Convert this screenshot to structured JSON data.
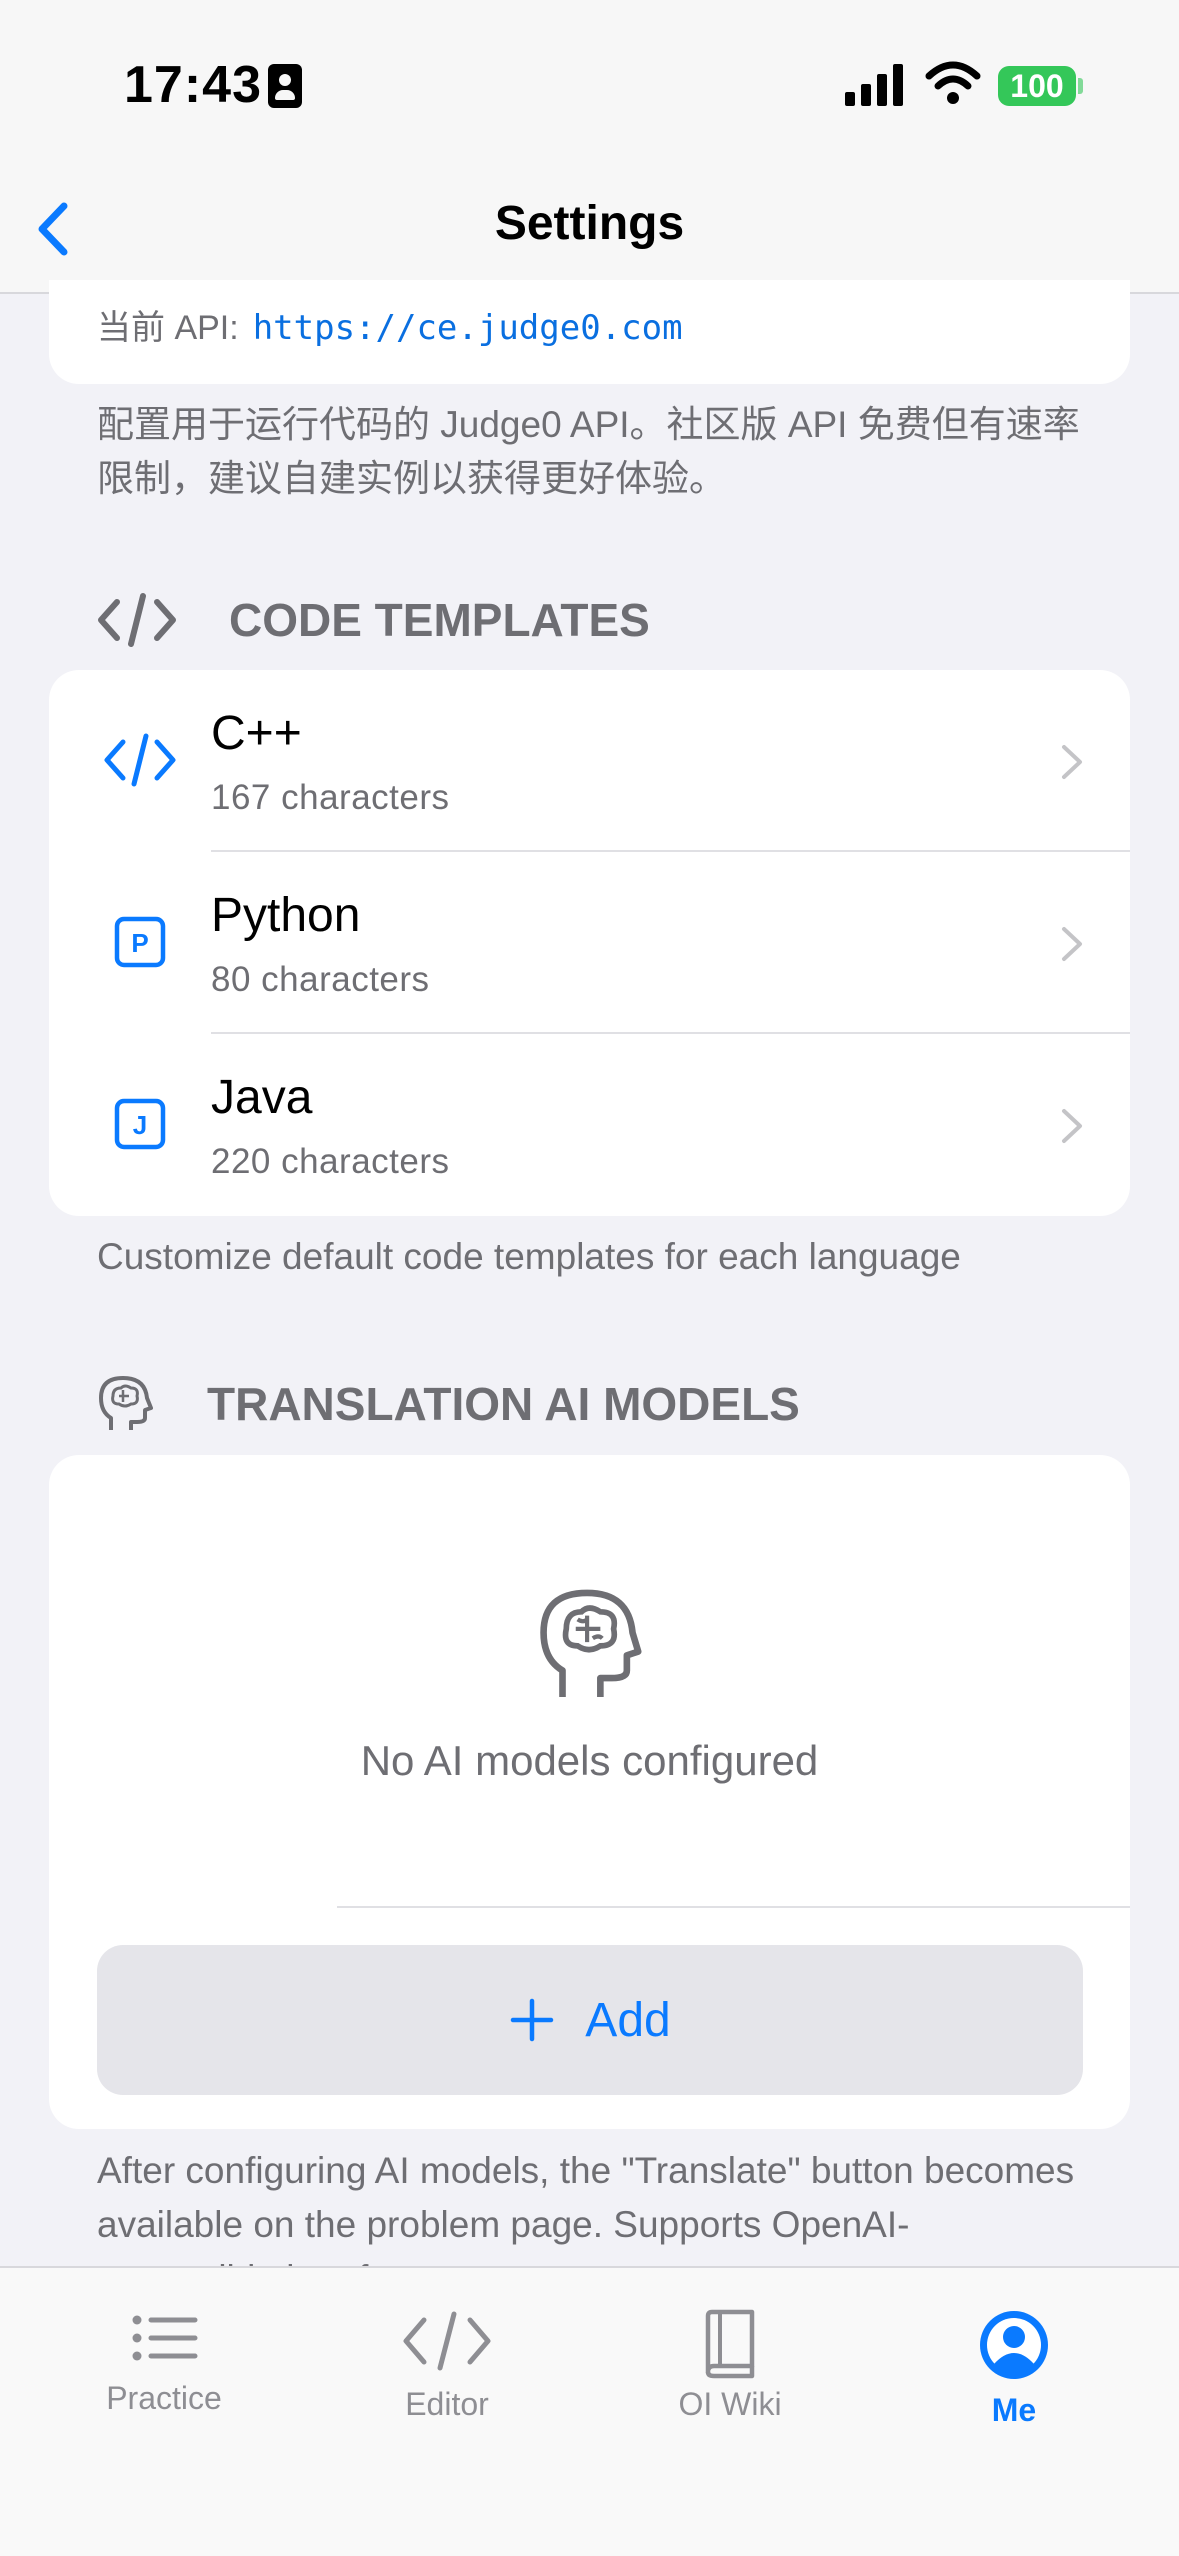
{
  "status_bar": {
    "time": "17:43",
    "battery": "100"
  },
  "nav": {
    "title": "Settings"
  },
  "api": {
    "label": "当前 API:",
    "url": "https://ce.judge0.com",
    "footnote": "配置用于运行代码的 Judge0 API。社区版 API 免费但有速率限制，建议自建实例以获得更好体验。"
  },
  "templates": {
    "header": "CODE TEMPLATES",
    "items": [
      {
        "name": "C++",
        "detail": "167 characters",
        "icon": "code-brackets-icon"
      },
      {
        "name": "Python",
        "detail": "80 characters",
        "icon": "letter-p-square-icon",
        "letter": "P"
      },
      {
        "name": "Java",
        "detail": "220 characters",
        "icon": "letter-j-square-icon",
        "letter": "J"
      }
    ],
    "footnote": "Customize default code templates for each language"
  },
  "ai_models": {
    "header": "TRANSLATION AI MODELS",
    "empty_text": "No AI models configured",
    "add_label": "Add",
    "footnote": "After configuring AI models, the \"Translate\" button becomes available on the problem page. Supports OpenAI-compatible interfaces."
  },
  "tabs": [
    {
      "label": "Practice",
      "icon": "list-icon"
    },
    {
      "label": "Editor",
      "icon": "code-icon"
    },
    {
      "label": "OI Wiki",
      "icon": "book-icon"
    },
    {
      "label": "Me",
      "icon": "person-circle-icon",
      "active": true
    }
  ],
  "colors": {
    "accent": "#0a7aff",
    "background": "#f2f2f7",
    "secondary_text": "#6e6e73",
    "battery": "#34c759"
  }
}
